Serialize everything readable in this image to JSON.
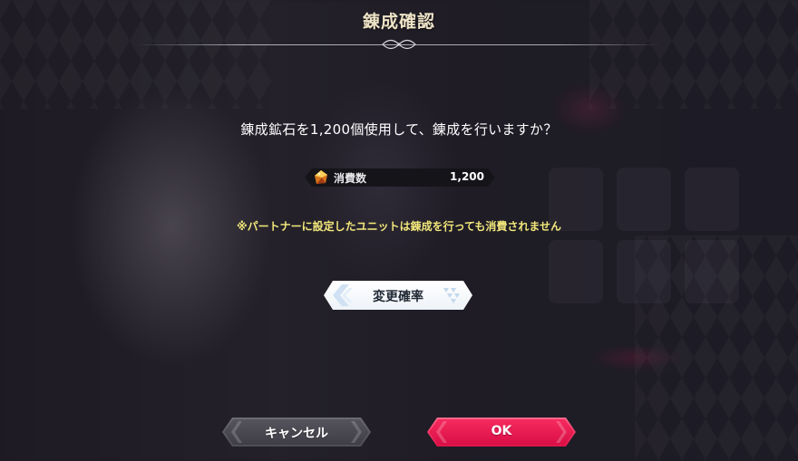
{
  "dialog": {
    "title": "錬成確認",
    "message": "錬成鉱石を1,200個使用して、錬成を行いますか？",
    "cost": {
      "label": "消費数",
      "value": "1,200",
      "icon": "ore-icon"
    },
    "notice": "※パートナーに設定したユニットは錬成を行っても消費されません",
    "probability_button": "変更確率",
    "cancel_button": "キャンセル",
    "ok_button": "OK"
  },
  "colors": {
    "title_text": "#eee3c6",
    "notice_text": "#f2e77a",
    "ok_button": "#f0245a",
    "cancel_button": "#4a4850",
    "probability_button": "#f4f7fb"
  }
}
